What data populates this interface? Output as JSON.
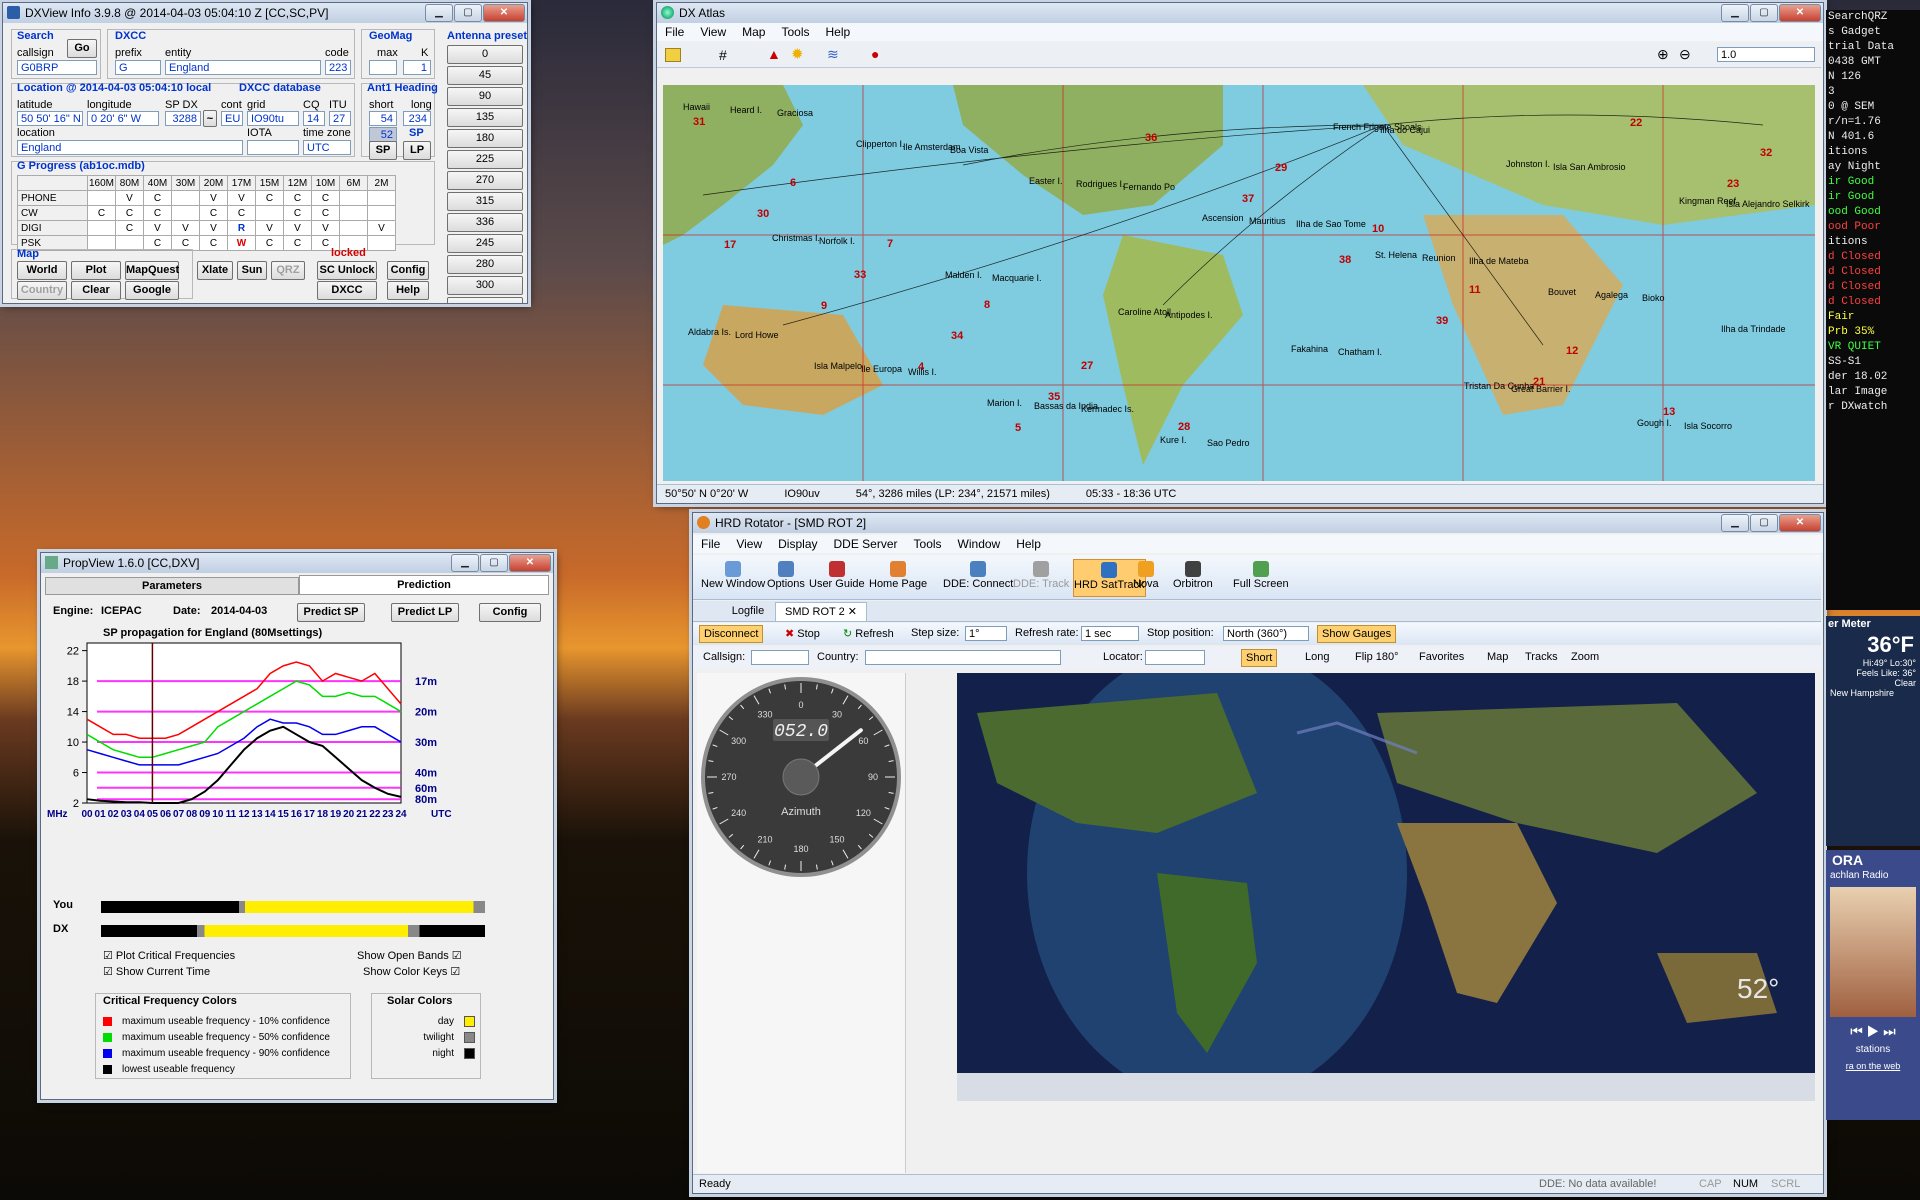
{
  "dxview": {
    "title": "DXView Info 3.9.8 @ 2014-04-03  05:04:10 Z  [CC,SC,PV]",
    "search": {
      "header": "Search",
      "callsign_label": "callsign",
      "go": "Go",
      "callsign": "G0BRP"
    },
    "dxcc": {
      "header": "DXCC",
      "prefix_label": "prefix",
      "entity_label": "entity",
      "code_label": "code",
      "prefix": "G",
      "entity": "England",
      "code": "223"
    },
    "geomag": {
      "header": "GeoMag",
      "max_label": "max",
      "k_label": "K",
      "max": "",
      "k": "1"
    },
    "location": {
      "header": "Location @ 2014-04-03 05:04:10 local",
      "db_header": "DXCC database",
      "lat_label": "latitude",
      "lon_label": "longitude",
      "spdx_label": "SP DX",
      "cont_label": "cont",
      "grid_label": "grid",
      "cq_label": "CQ",
      "itu_label": "ITU",
      "lat": "50 50' 16\" N",
      "lon": "0 20' 6\" W",
      "spdx": "3288",
      "cont": "EU",
      "grid": "IO90tu",
      "cq": "14",
      "itu": "27",
      "loc_label": "location",
      "iota_label": "IOTA",
      "tz_label": "time zone",
      "location": "England",
      "iota": "",
      "tz": "UTC"
    },
    "ant1": {
      "header": "Ant1 Heading",
      "short_label": "short",
      "long_label": "long",
      "short": "54",
      "long": "234",
      "cur": "52",
      "sp": "SP",
      "lp": "LP"
    },
    "presets": {
      "header": "Antenna presets",
      "values": [
        "0",
        "45",
        "90",
        "135",
        "180",
        "225",
        "270",
        "315",
        "336",
        "245",
        "280",
        "300",
        ""
      ]
    },
    "progress": {
      "header": "G Progress (ab1oc.mdb)",
      "bands": [
        "",
        "160M",
        "80M",
        "40M",
        "30M",
        "20M",
        "17M",
        "15M",
        "12M",
        "10M",
        "6M",
        "2M"
      ],
      "rows": [
        [
          "PHONE",
          "",
          "V",
          "C",
          "",
          "V",
          "V",
          "C",
          "C",
          "C",
          "",
          ""
        ],
        [
          "CW",
          "C",
          "C",
          "C",
          "",
          "C",
          "C",
          "",
          "C",
          "C",
          "",
          ""
        ],
        [
          "DIGI",
          "",
          "C",
          "V",
          "V",
          "V",
          "R",
          "V",
          "V",
          "V",
          "",
          "V"
        ],
        [
          "PSK",
          "",
          "",
          "C",
          "C",
          "C",
          "W",
          "C",
          "C",
          "C",
          "",
          ""
        ]
      ]
    },
    "map": {
      "header": "Map",
      "locked": "locked",
      "world": "World",
      "plot": "Plot",
      "mapquest": "MapQuest",
      "xlate": "Xlate",
      "sun": "Sun",
      "qrz": "QRZ",
      "scunlock": "SC Unlock",
      "config": "Config",
      "country": "Country",
      "clear": "Clear",
      "google": "Google",
      "dxcc": "DXCC",
      "help": "Help"
    }
  },
  "dxatlas": {
    "title": "DX Atlas",
    "menu": [
      "File",
      "View",
      "Map",
      "Tools",
      "Help"
    ],
    "zoom": "1.0",
    "status": [
      "50°50' N  0°20' W",
      "IO90uv",
      "54°, 3286 miles  (LP: 234°, 21571 miles)",
      "05:33 - 18:36 UTC"
    ],
    "zones": [
      "31",
      "6",
      "7",
      "8",
      "27",
      "28",
      "29",
      "10",
      "11",
      "12",
      "13",
      "32",
      "30",
      "33",
      "34",
      "35",
      "36",
      "37",
      "38",
      "39",
      "21",
      "22",
      "23",
      "17",
      "9",
      "4",
      "5"
    ],
    "places": [
      "Hawaii",
      "Clipperton I.",
      "Easter I.",
      "Ascension",
      "St. Helena",
      "Bouvet",
      "Ilha da Trindade",
      "Isla Malpelo",
      "Marion I.",
      "Kure I.",
      "French Frigate Shoals",
      "Johnston I.",
      "Kingman Reef",
      "Christmas I.",
      "Malden I.",
      "Caroline Atoll",
      "Fakahina",
      "Tristan Da Cunha",
      "Gough I.",
      "Heard I.",
      "Ile Amsterdam",
      "Rodrigues I.",
      "Mauritius",
      "Reunion",
      "Agalega",
      "Aldabra Is.",
      "Ile Europa",
      "Bassas da India",
      "Sao Pedro",
      "Ilha do Cajui",
      "Isla San Ambrosio",
      "Isla Alejandro Selkirk",
      "Norfolk I.",
      "Macquarie I.",
      "Antipodes I.",
      "Chatham I.",
      "Great Barrier I.",
      "Isla Socorro",
      "Graciosa",
      "Boa Vista",
      "Fernando Po",
      "Ilha de Sao Tome",
      "Ilha de Mateba",
      "Bioko",
      "Lord Howe",
      "Willis I.",
      "Kermadec Is."
    ]
  },
  "propview": {
    "title": "PropView 1.6.0  [CC,DXV]",
    "tabs": [
      "Parameters",
      "Prediction"
    ],
    "engine_label": "Engine:",
    "engine": "ICEPAC",
    "date_label": "Date:",
    "date": "2014-04-03",
    "predict_sp": "Predict SP",
    "predict_lp": "Predict LP",
    "config": "Config",
    "chart_title": "SP propagation for England (80Msettings)",
    "y_ticks": [
      "22",
      "18",
      "14",
      "10",
      "6",
      "2"
    ],
    "mhz": "MHz",
    "utc": "UTC",
    "hours": [
      "00",
      "01",
      "02",
      "03",
      "04",
      "05",
      "06",
      "07",
      "08",
      "09",
      "10",
      "11",
      "12",
      "13",
      "14",
      "15",
      "16",
      "17",
      "18",
      "19",
      "20",
      "21",
      "22",
      "23",
      "24"
    ],
    "band_labels": [
      "17m",
      "20m",
      "30m",
      "40m",
      "60m",
      "80m"
    ],
    "you": "You",
    "dx": "DX",
    "chk_plot": "Plot Critical Frequencies",
    "chk_time": "Show Current Time",
    "chk_open": "Show Open Bands",
    "chk_keys": "Show Color Keys",
    "crit_header": "Critical Frequency Colors",
    "crit": [
      "maximum useable frequency  - 10% confidence",
      "maximum useable frequency  - 50% confidence",
      "maximum useable frequency  - 90% confidence",
      "lowest useable frequency"
    ],
    "solar_header": "Solar Colors",
    "solar": [
      "day",
      "twilight",
      "night"
    ]
  },
  "chart_data": {
    "type": "line",
    "title": "SP propagation for England (80Msettings)",
    "xlabel": "UTC",
    "ylabel": "MHz",
    "x": [
      0,
      1,
      2,
      3,
      4,
      5,
      6,
      7,
      8,
      9,
      10,
      11,
      12,
      13,
      14,
      15,
      16,
      17,
      18,
      19,
      20,
      21,
      22,
      23,
      24
    ],
    "ylim": [
      2,
      23
    ],
    "series": [
      {
        "name": "maximum useable frequency  - 10% confidence",
        "color": "#ff0000",
        "values": [
          13,
          12,
          11,
          11,
          10.5,
          10.5,
          10.5,
          11,
          12,
          13,
          14,
          15,
          16,
          17,
          19,
          20,
          20.5,
          20,
          18,
          19,
          18.5,
          18,
          19,
          17,
          15
        ]
      },
      {
        "name": "maximum useable frequency  - 50% confidence",
        "color": "#00dd00",
        "values": [
          11,
          10,
          9,
          8.5,
          8,
          8,
          8.5,
          9,
          9.5,
          10,
          12,
          13,
          14,
          15,
          16,
          17,
          18,
          17.5,
          16,
          16,
          16.5,
          16,
          16,
          15,
          14
        ]
      },
      {
        "name": "maximum useable frequency  - 90% confidence",
        "color": "#0000ee",
        "values": [
          9,
          8.5,
          8,
          7.5,
          7,
          7,
          7,
          7,
          7.5,
          8,
          8.5,
          9.5,
          10.5,
          12,
          13,
          12.5,
          12.5,
          12,
          11,
          11,
          11.5,
          12,
          12,
          11,
          10
        ]
      },
      {
        "name": "lowest useable frequency",
        "color": "#000000",
        "values": [
          2.5,
          2.3,
          2.2,
          2.1,
          2.1,
          2,
          2,
          2,
          2.5,
          3.5,
          5,
          7,
          9,
          10.5,
          11.5,
          12,
          11,
          10,
          9.5,
          8,
          6.5,
          5,
          4,
          3.2,
          2.8
        ]
      }
    ]
  },
  "hrd": {
    "title": "HRD Rotator - [SMD ROT 2]",
    "menu": [
      "File",
      "View",
      "Display",
      "DDE Server",
      "Tools",
      "Window",
      "Help"
    ],
    "ribbon": [
      "New Window",
      "Options",
      "User Guide",
      "Home Page",
      "DDE: Connect",
      "DDE: Track",
      "HRD SatTrack",
      "Nova",
      "Orbitron",
      "Full Screen"
    ],
    "tabs": [
      "Logfile",
      "SMD ROT 2"
    ],
    "bar1": {
      "disconnect": "Disconnect",
      "stop": "Stop",
      "refresh": "Refresh",
      "step_label": "Step size:",
      "step": "1°",
      "rate_label": "Refresh rate:",
      "rate": "1 sec",
      "stop_label": "Stop position:",
      "stop_pos": "North (360°)",
      "gauges": "Show Gauges"
    },
    "bar2": {
      "callsign_label": "Callsign:",
      "country_label": "Country:",
      "locator_label": "Locator:",
      "short": "Short",
      "long": "Long",
      "flip": "Flip 180°",
      "favorites": "Favorites",
      "map": "Map",
      "tracks": "Tracks",
      "zoom": "Zoom"
    },
    "gauge": {
      "reading": "052.0",
      "label": "Azimuth",
      "ticks": [
        "0",
        "30",
        "60",
        "90",
        "120",
        "150",
        "180",
        "210",
        "240",
        "270",
        "300",
        "330"
      ],
      "azimuth": 52
    },
    "map_heading": "52°",
    "status": {
      "ready": "Ready",
      "dde": "DDE: No data available!",
      "cap": "CAP",
      "num": "NUM",
      "scrl": "SCRL"
    }
  },
  "gadget": {
    "lines": [
      "SearchQRZ",
      "s Gadget",
      "trial Data",
      "0438 GMT",
      "N   126",
      "3",
      "0 @ SEM",
      "r/n=1.76",
      "N  401.6",
      "itions",
      "ay Night",
      "ir  Good",
      "ir  Good",
      "ood  Good",
      "ood  Poor",
      "itions",
      "d Closed",
      "d Closed",
      "d Closed",
      "d Closed",
      "Fair",
      "Prb  35%",
      "VR QUIET",
      "SS-S1",
      "der  18.02",
      "lar Image",
      "r DXwatch"
    ],
    "weather_header": "er Meter",
    "temp": "36°F",
    "hi_lo": "Hi:49° Lo:30°",
    "feels": "Feels Like: 36°",
    "clear": "Clear",
    "place": "New Hampshire",
    "radio_header": "ORA",
    "radio_sub": "achlan Radio",
    "stations": "stations",
    "web": "ra on the web"
  }
}
